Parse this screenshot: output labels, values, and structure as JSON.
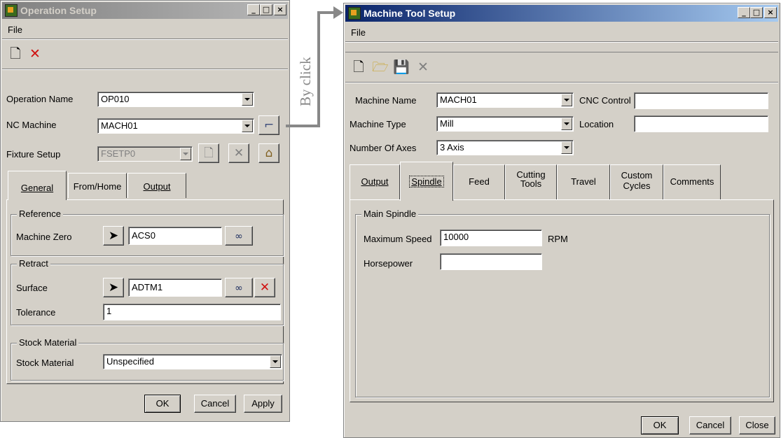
{
  "op_window": {
    "title": "Operation Setup",
    "menu_file": "File",
    "fields": {
      "operation_name_label": "Operation Name",
      "operation_name_value": "OP010",
      "nc_machine_label": "NC Machine",
      "nc_machine_value": "MACH01",
      "fixture_setup_label": "Fixture Setup",
      "fixture_setup_value": "FSETP0"
    },
    "tabs": [
      "General",
      "From/Home",
      "Output"
    ],
    "reference": {
      "title": "Reference",
      "machine_zero_label": "Machine Zero",
      "machine_zero_value": "ACS0"
    },
    "retract": {
      "title": "Retract",
      "surface_label": "Surface",
      "surface_value": "ADTM1",
      "tolerance_label": "Tolerance",
      "tolerance_value": "1"
    },
    "stock": {
      "title": "Stock Material",
      "label": "Stock Material",
      "value": "Unspecified"
    },
    "buttons": {
      "ok": "OK",
      "cancel": "Cancel",
      "apply": "Apply"
    }
  },
  "connector_label": "By click",
  "mt_window": {
    "title": "Machine Tool Setup",
    "menu_file": "File",
    "fields": {
      "machine_name_label": "Machine Name",
      "machine_name_value": "MACH01",
      "cnc_control_label": "CNC Control",
      "cnc_control_value": "",
      "machine_type_label": "Machine Type",
      "machine_type_value": "Mill",
      "location_label": "Location",
      "location_value": "",
      "num_axes_label": "Number Of Axes",
      "num_axes_value": "3 Axis"
    },
    "tabs": {
      "output": "Output",
      "spindle": "Spindle",
      "feed": "Feed",
      "cutting_1": "Cutting",
      "cutting_2": "Tools",
      "travel": "Travel",
      "custom_1": "Custom",
      "custom_2": "Cycles",
      "comments": "Comments"
    },
    "spindle": {
      "group_title": "Main Spindle",
      "max_speed_label": "Maximum Speed",
      "max_speed_value": "10000",
      "unit": "RPM",
      "horsepower_label": "Horsepower",
      "horsepower_value": ""
    },
    "buttons": {
      "ok": "OK",
      "cancel": "Cancel",
      "close": "Close"
    }
  },
  "colors": {
    "active_title": "#0a246a",
    "inactive_title": "#808080",
    "face": "#d4d0c8",
    "red_icon": "#d01010",
    "connector": "#888888"
  }
}
